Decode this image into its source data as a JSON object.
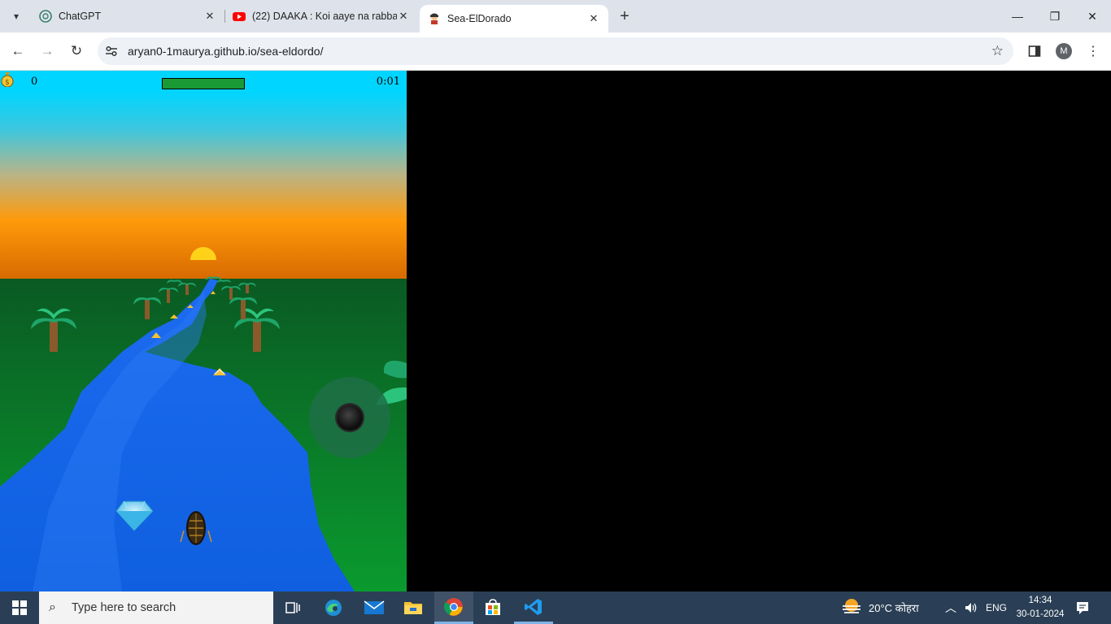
{
  "browser": {
    "tabs": [
      {
        "title": "ChatGPT",
        "favicon": "chatgpt-icon"
      },
      {
        "title": "(22) DAAKA : Koi aaye na rabba",
        "favicon": "youtube-icon"
      },
      {
        "title": "Sea-ElDorado",
        "favicon": "sea-eldorado-icon",
        "active": true
      }
    ],
    "address": "aryan0-1maurya.github.io/sea-eldordo/",
    "profile_initial": "M"
  },
  "game": {
    "coins": "0",
    "timer": "0:01",
    "health_fraction": 1.0,
    "colors": {
      "sky_top": "#00d5ff",
      "sunset": "#ff9a0a",
      "grass": "#0a6f2a",
      "river": "#1863e6"
    }
  },
  "taskbar": {
    "search_placeholder": "Type here to search",
    "weather": "20°C कोहरा",
    "language": "ENG",
    "time": "14:34",
    "date": "30-01-2024"
  }
}
